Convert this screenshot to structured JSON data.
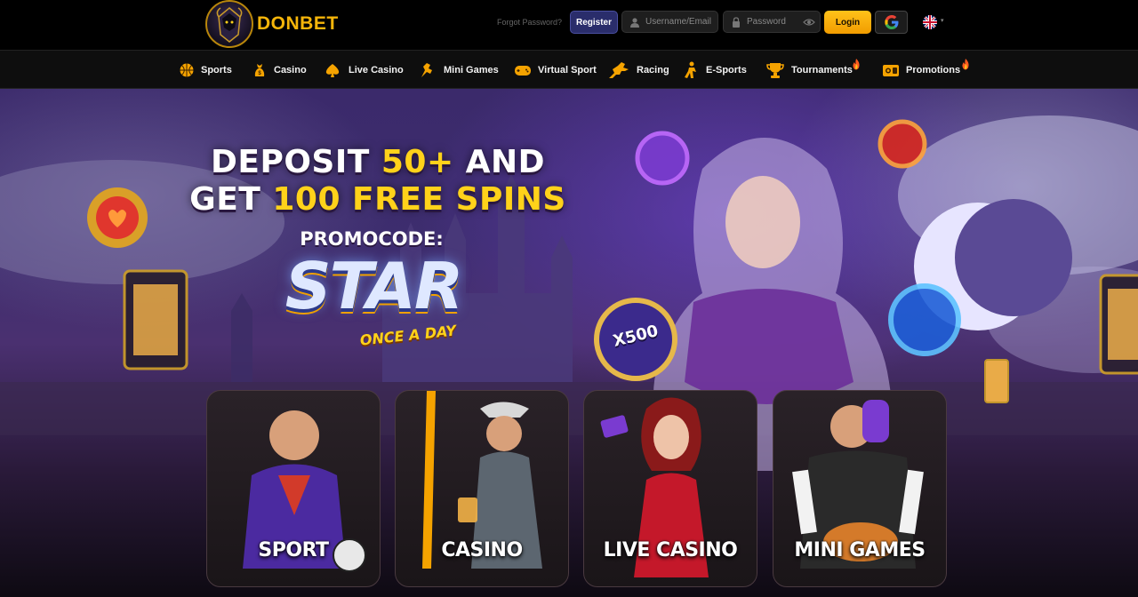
{
  "header": {
    "logo_text": "DONBET",
    "forgot_password": "Forgot Password?",
    "register_label": "Register",
    "username_placeholder": "Username/Email",
    "password_placeholder": "Password",
    "login_label": "Login",
    "language": "en-GB"
  },
  "nav": {
    "items": [
      {
        "label": "Sports",
        "icon": "sports-icon"
      },
      {
        "label": "Casino",
        "icon": "casino-icon"
      },
      {
        "label": "Live Casino",
        "icon": "live-casino-icon"
      },
      {
        "label": "Mini Games",
        "icon": "mini-games-icon"
      },
      {
        "label": "Virtual Sport",
        "icon": "virtual-sport-icon"
      },
      {
        "label": "Racing",
        "icon": "racing-icon"
      },
      {
        "label": "E-Sports",
        "icon": "esports-icon"
      },
      {
        "label": "Tournaments",
        "icon": "tournaments-icon",
        "hot": true
      },
      {
        "label": "Promotions",
        "icon": "promotions-icon",
        "hot": true
      }
    ]
  },
  "hero": {
    "line1_white": "DEPOSIT ",
    "line1_yellow": "50+",
    "line1_white2": " AND",
    "line2_white": "GET ",
    "line2_yellow": "100 FREE SPINS",
    "promo_label": "PROMOCODE:",
    "promo_code": "STAR",
    "promo_sub": "ONCE A DAY",
    "badge_multiplier": "X500"
  },
  "categories": [
    {
      "label": "SPORT"
    },
    {
      "label": "CASINO"
    },
    {
      "label": "LIVE CASINO"
    },
    {
      "label": "MINI GAMES"
    }
  ],
  "colors": {
    "accent": "#f5b50a",
    "register_bg": "#2a2d6b",
    "login_bg": "#ffb400",
    "headline_yellow": "#ffd21a"
  }
}
